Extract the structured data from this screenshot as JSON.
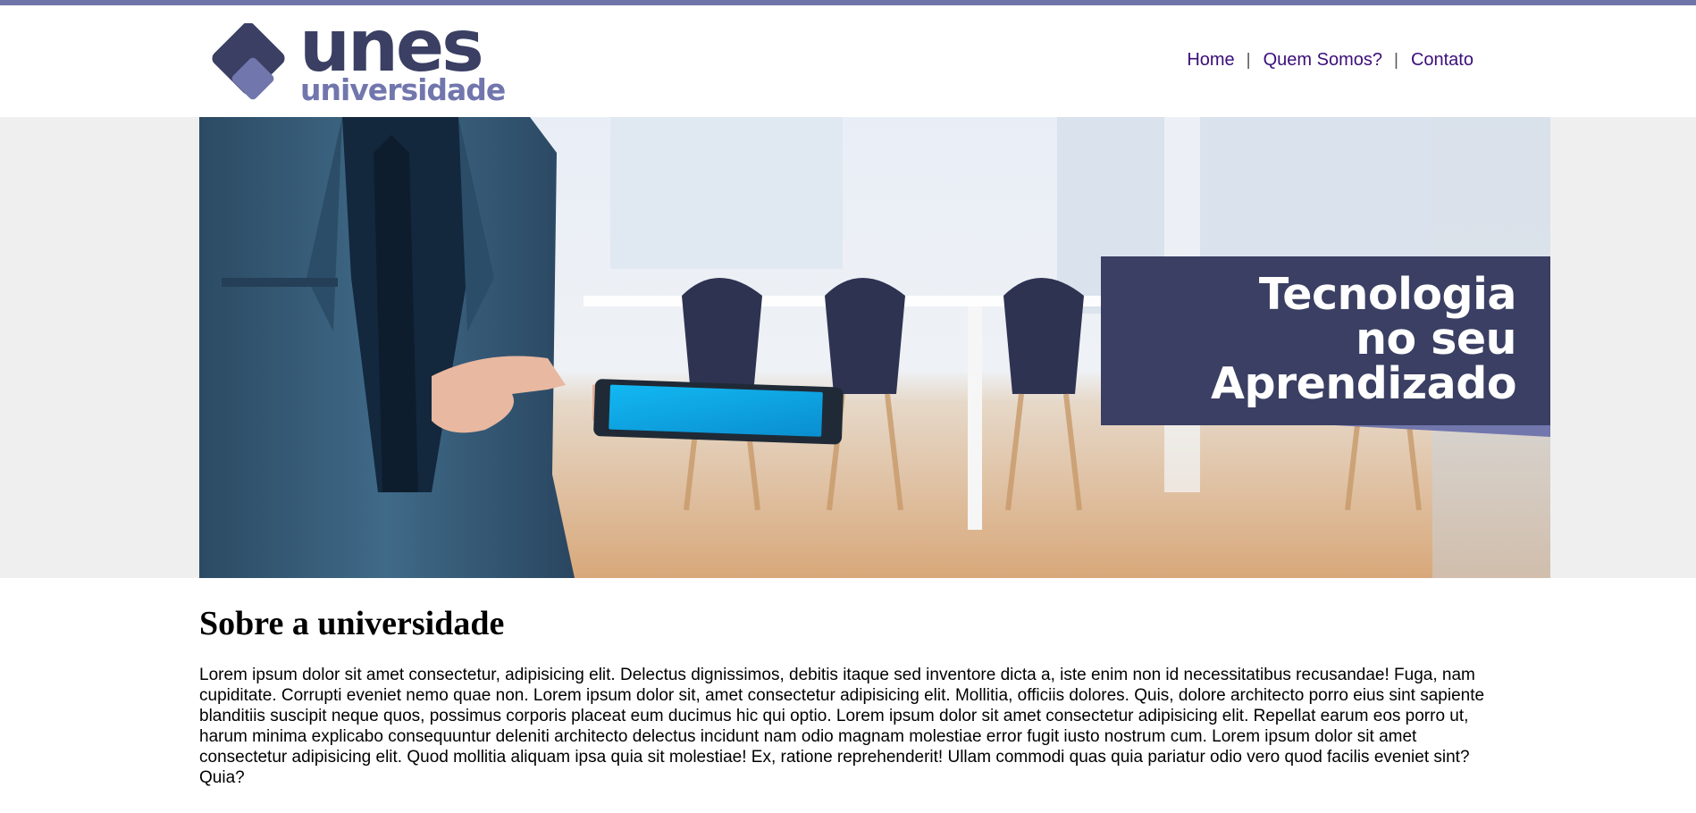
{
  "brand": {
    "name": "unes",
    "subtitle": "universidade",
    "colors": {
      "dark": "#3a3f63",
      "accent": "#7176ad",
      "nav_link": "#3b0e7a"
    }
  },
  "nav": {
    "items": [
      {
        "label": "Home"
      },
      {
        "label": "Quem Somos?"
      },
      {
        "label": "Contato"
      }
    ],
    "separator": "|"
  },
  "hero": {
    "banner_lines": [
      "Tecnologia",
      "no seu",
      "Aprendizado"
    ]
  },
  "about": {
    "heading": "Sobre a universidade",
    "paragraph": "Lorem ipsum dolor sit amet consectetur, adipisicing elit. Delectus dignissimos, debitis itaque sed inventore dicta a, iste enim non id necessitatibus recusandae! Fuga, nam cupiditate. Corrupti eveniet nemo quae non. Lorem ipsum dolor sit, amet consectetur adipisicing elit. Mollitia, officiis dolores. Quis, dolore architecto porro eius sint sapiente blanditiis suscipit neque quos, possimus corporis placeat eum ducimus hic qui optio. Lorem ipsum dolor sit amet consectetur adipisicing elit. Repellat earum eos porro ut, harum minima explicabo consequuntur deleniti architecto delectus incidunt nam odio magnam molestiae error fugit iusto nostrum cum. Lorem ipsum dolor sit amet consectetur adipisicing elit. Quod mollitia aliquam ipsa quia sit molestiae! Ex, ratione reprehenderit! Ullam commodi quas quia pariatur odio vero quod facilis eveniet sint? Quia?"
  }
}
